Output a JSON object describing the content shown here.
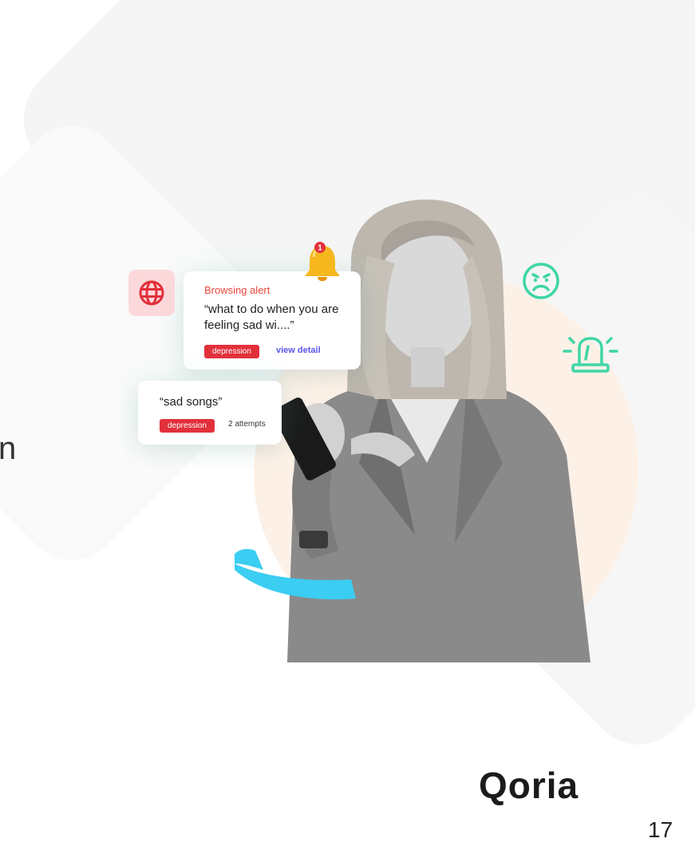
{
  "slide": {
    "partial_heading_letter": "n",
    "page_number": "17"
  },
  "browsing_card": {
    "title": "Browsing alert",
    "query": "“what to do when you are feeling sad wi....”",
    "tag": "depression",
    "link": "view detail"
  },
  "songs_card": {
    "query": "“sad songs”",
    "tag": "depression",
    "attempts": "2 attempts"
  },
  "notification": {
    "badge_count": "1"
  },
  "brand": {
    "name": "Qoria"
  },
  "colors": {
    "alert_red": "#e2303b",
    "link_purple": "#5b55e8",
    "emoji_green": "#3ed6a6",
    "swoosh_blue": "#3bcdf2",
    "blob_peach": "#fdf1e7"
  },
  "icons": [
    "globe-icon",
    "bell-icon",
    "angry-face-icon",
    "siren-icon"
  ]
}
